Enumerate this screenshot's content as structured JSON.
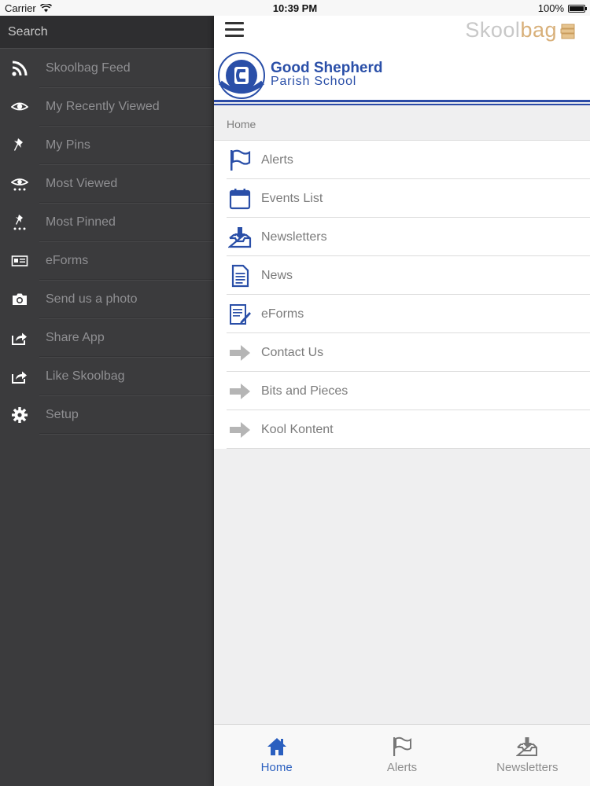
{
  "status_bar": {
    "carrier": "Carrier",
    "time": "10:39 PM",
    "battery": "100%",
    "battery_level": 1.0
  },
  "sidebar": {
    "search_placeholder": "Search",
    "items": [
      {
        "label": "Skoolbag Feed",
        "icon": "rss-icon"
      },
      {
        "label": "My Recently Viewed",
        "icon": "eye-icon"
      },
      {
        "label": "My Pins",
        "icon": "pin-icon"
      },
      {
        "label": "Most Viewed",
        "icon": "eye-dots-icon"
      },
      {
        "label": "Most Pinned",
        "icon": "pin-dots-icon"
      },
      {
        "label": "eForms",
        "icon": "id-card-icon"
      },
      {
        "label": "Send us a photo",
        "icon": "camera-icon"
      },
      {
        "label": "Share App",
        "icon": "share-icon"
      },
      {
        "label": "Like Skoolbag",
        "icon": "share-icon"
      },
      {
        "label": "Setup",
        "icon": "gear-icon"
      }
    ]
  },
  "topbar": {
    "brand_prefix": "Skool",
    "brand_suffix": "bag"
  },
  "school": {
    "name": "Good Shepherd",
    "subtitle": "Parish School"
  },
  "breadcrumb": "Home",
  "menu": [
    {
      "label": "Alerts",
      "icon": "flag-icon"
    },
    {
      "label": "Events List",
      "icon": "calendar-icon"
    },
    {
      "label": "Newsletters",
      "icon": "inbox-download-icon"
    },
    {
      "label": "News",
      "icon": "document-icon"
    },
    {
      "label": "eForms",
      "icon": "form-pen-icon"
    },
    {
      "label": "Contact Us",
      "icon": "arrow-right-icon"
    },
    {
      "label": "Bits and Pieces",
      "icon": "arrow-right-icon"
    },
    {
      "label": "Kool Kontent",
      "icon": "arrow-right-icon"
    }
  ],
  "tabs": [
    {
      "label": "Home",
      "icon": "home-icon",
      "active": true
    },
    {
      "label": "Alerts",
      "icon": "flag-icon",
      "active": false
    },
    {
      "label": "Newsletters",
      "icon": "inbox-download-icon",
      "active": false
    }
  ],
  "colors": {
    "accent_blue": "#2a5fbf",
    "sidebar_bg": "#3b3b3d",
    "brand_gold": "#d8b07a"
  }
}
